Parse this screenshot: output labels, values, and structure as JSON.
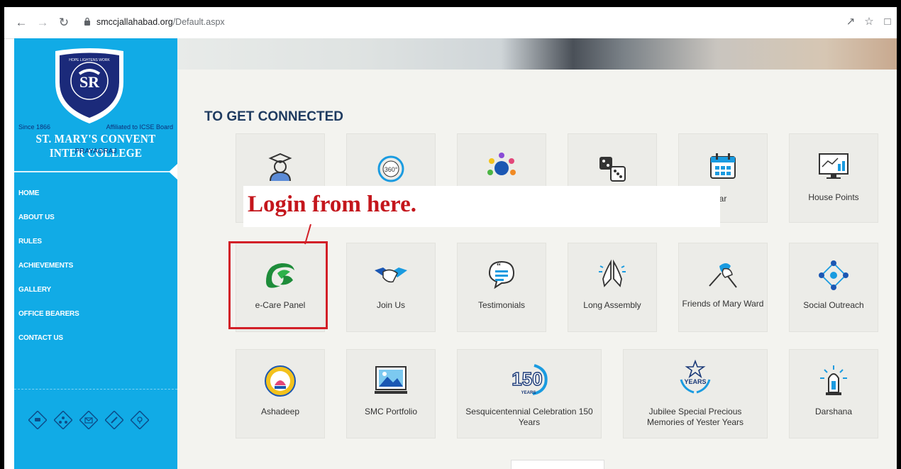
{
  "browser": {
    "url_host": "smccjallahabad.org",
    "url_path": "/Default.aspx",
    "icons": [
      "back-arrow-icon",
      "forward-arrow-icon",
      "reload-icon",
      "lock-icon",
      "share-icon",
      "star-icon",
      "window-icon"
    ]
  },
  "sidebar": {
    "since": "Since 1866",
    "affiliation": "Affiliated to ICSE Board",
    "school_name": "ST. MARY'S CONVENT INTER COLLEGE",
    "city": "PRAYAGRAJ",
    "crest_motto": "HOPE LIGHTENS WORK",
    "menu": [
      "HOME",
      "ABOUT US",
      "RULES",
      "ACHIEVEMENTS",
      "GALLERY",
      "OFFICE BEARERS",
      "CONTACT US"
    ],
    "social_icons": [
      "chat-icon",
      "network-icon",
      "mail-icon",
      "pen-icon",
      "location-icon"
    ]
  },
  "main": {
    "section_title": "TO GET CONNECTED",
    "row1": [
      {
        "label": "",
        "icon": "graduate-icon"
      },
      {
        "label": "",
        "icon": "360-view-icon"
      },
      {
        "label": "",
        "icon": "peacock-icon"
      },
      {
        "label": "",
        "icon": "dice-icon"
      },
      {
        "label": "ar",
        "icon": "calendar-icon"
      },
      {
        "label": "House Points",
        "icon": "chart-monitor-icon"
      }
    ],
    "row2": [
      {
        "label": "e-Care Panel",
        "icon": "ecare-logo-icon"
      },
      {
        "label": "Join Us",
        "icon": "handshake-icon"
      },
      {
        "label": "Testimonials",
        "icon": "quote-bubble-icon"
      },
      {
        "label": "Long Assembly",
        "icon": "praying-hands-icon"
      },
      {
        "label": "Friends of Mary Ward",
        "icon": "fist-bump-icon"
      },
      {
        "label": "Social Outreach",
        "icon": "network-nodes-icon"
      }
    ],
    "row3": [
      {
        "label": "Ashadeep",
        "icon": "ashadeep-emblem-icon"
      },
      {
        "label": "SMC Portfolio",
        "icon": "picture-frame-icon"
      },
      {
        "label": "Sesquicentennial Celebration 150 Years",
        "icon": "150-years-icon",
        "badge": "150",
        "badge_sub": "YEARS"
      },
      {
        "label": "Jubilee Special Precious Memories of Yester Years",
        "icon": "jubilee-years-icon",
        "badge": "YEARS"
      },
      {
        "label": "Darshana",
        "icon": "darshana-icon"
      }
    ]
  },
  "annotation": {
    "callout_text": "Login from here."
  },
  "colors": {
    "sidebar": "#11abe6",
    "title": "#1f3b60",
    "highlight": "#d21f27"
  }
}
